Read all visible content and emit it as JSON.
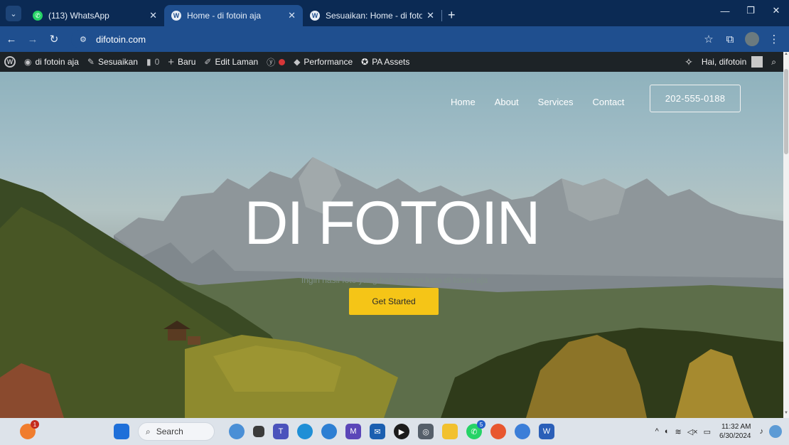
{
  "browser": {
    "tabs": [
      {
        "title": "(113) WhatsApp",
        "favicon": "whatsapp-icon",
        "active": false
      },
      {
        "title": "Home - di fotoin aja",
        "favicon": "wordpress-icon",
        "active": true
      },
      {
        "title": "Sesuaikan: Home - di fotoin aja",
        "favicon": "wordpress-icon",
        "active": false
      }
    ],
    "url": "difotoin.com"
  },
  "adminbar": {
    "site_name": "di fotoin aja",
    "customize": "Sesuaikan",
    "comments_count": "0",
    "new": "Baru",
    "edit_page": "Edit Laman",
    "performance": "Performance",
    "pa_assets": "PA Assets",
    "greeting": "Hai, difotoin"
  },
  "site": {
    "nav": [
      "Home",
      "About",
      "Services",
      "Contact"
    ],
    "phone": "202-555-0188",
    "title": "DI FOTOIN",
    "subtitle": "Ingin hasil foto yang baik jangan lupa di fotoin aja",
    "cta": "Get Started"
  },
  "taskbar": {
    "search_placeholder": "Search",
    "time": "11:32 AM",
    "date": "6/30/2024",
    "notification_badge": "1",
    "whatsapp_badge": "5"
  },
  "colors": {
    "browser_frame": "#0b2a54",
    "toolbar": "#1f4f8f",
    "adminbar": "#1d2327",
    "cta": "#f5c517"
  }
}
